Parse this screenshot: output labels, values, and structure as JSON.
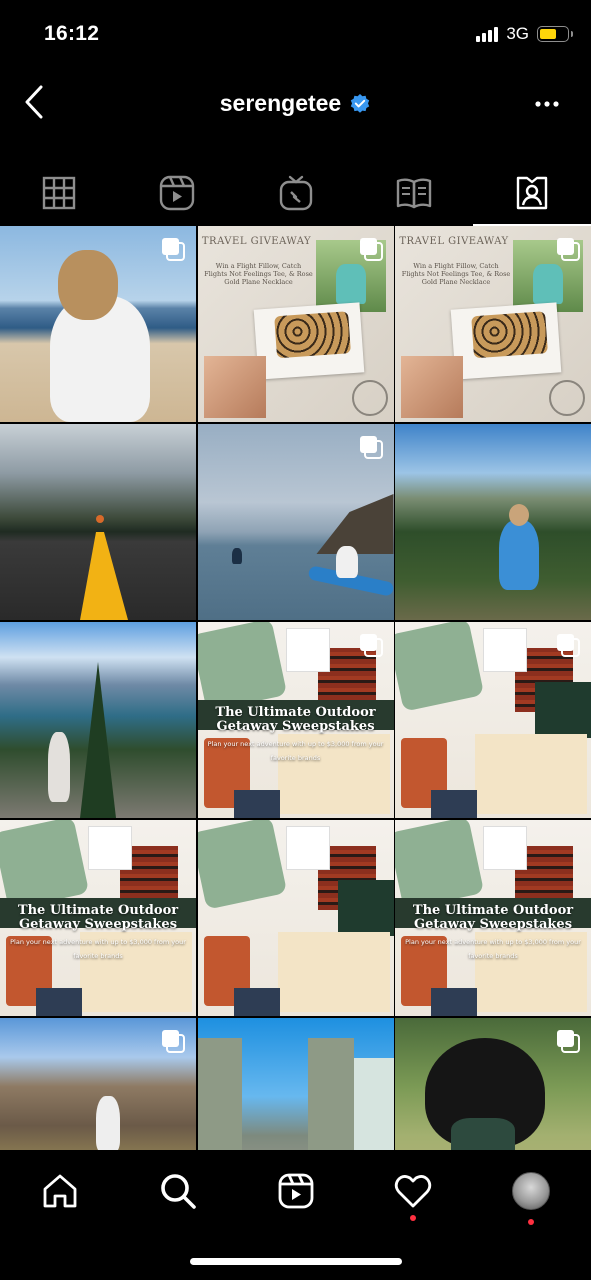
{
  "status": {
    "time": "16:12",
    "network": "3G"
  },
  "header": {
    "username": "serengetee",
    "verified": true
  },
  "tabs": [
    {
      "name": "grid",
      "icon": "grid-icon",
      "active": false
    },
    {
      "name": "reels",
      "icon": "reels-icon",
      "active": false
    },
    {
      "name": "igtv",
      "icon": "igtv-icon",
      "active": false
    },
    {
      "name": "guides",
      "icon": "guides-icon",
      "active": false
    },
    {
      "name": "tagged",
      "icon": "tagged-icon",
      "active": true
    }
  ],
  "posts": {
    "giveaway": {
      "title": "TRAVEL GIVEAWAY",
      "subtitle": "Win a Flight Fillow, Catch Flights Not Feelings Tee, & Rose Gold Plane Necklace"
    },
    "sweepstakes": {
      "title": "The Ultimate Outdoor Getaway Sweepstakes",
      "subtitle": "Plan your next adventure with up to $3,000 from your favorite brands"
    }
  },
  "bottom_nav": [
    "home-icon",
    "search-icon",
    "reels-icon",
    "heart-icon",
    "profile-avatar"
  ],
  "colors": {
    "background": "#000000",
    "verified": "#3897f0",
    "notification_dot": "#ff3040",
    "battery": "#ffd60a"
  }
}
